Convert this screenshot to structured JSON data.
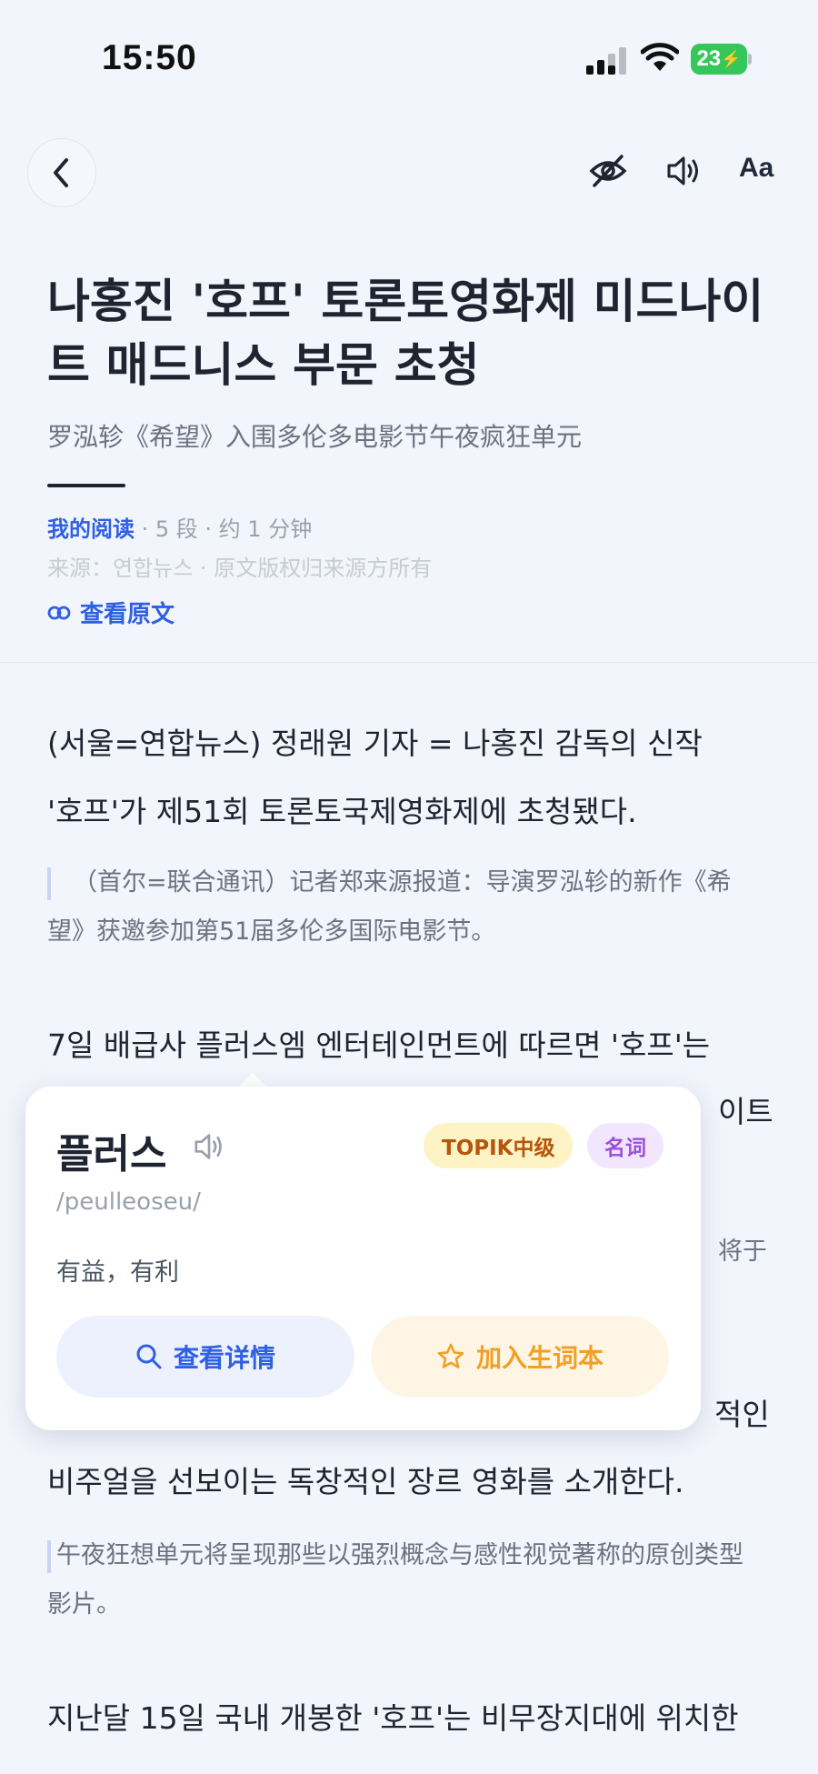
{
  "status_bar": {
    "time": "15:50",
    "battery": "23"
  },
  "nav": {
    "font_button": "Aa"
  },
  "article": {
    "title": "나홍진 '호프' 토론토영화제 미드나이트 매드니스 부문 초청",
    "subtitle": "罗泓轸《希望》入围多伦多电影节午夜疯狂单元",
    "meta": {
      "my_reading": "我的阅读",
      "stats": " · 5 段 · 约 1 分钟",
      "source": "来源：연합뉴스 · 原文版权归来源方所有",
      "view_original": "查看原文"
    },
    "paragraphs": [
      {
        "ko_lines": [
          "(서울=연합뉴스) 정래원 기자 = 나홍진 감독의 신작",
          "'호프'가 제51회 토론토국제영화제에 초청됐다."
        ],
        "zh": "（首尔=联合通讯）记者郑来源报道：导演罗泓轸的新作《希望》获邀参加第51届多伦多国际电影节。"
      },
      {
        "ko_line1": "7일 배급사 플러스엠 엔터테인먼트에 따르면 '호프'는",
        "ko_line2_tail": "이트",
        "zh_tail": "将于"
      },
      {
        "ko_line1_tail": "적인",
        "ko_line2": "비주얼을 선보이는 독창적인 장르 영화를 소개한다.",
        "zh": "午夜狂想单元将呈现那些以强烈概念与感性视觉著称的原创类型影片。"
      },
      {
        "ko_line1": "지난달 15일 국내 개봉한 '호프'는 비무장지대에 위치한"
      }
    ]
  },
  "word_popup": {
    "word": "플러스",
    "tag_level": "TOPIK中级",
    "tag_pos": "名词",
    "romanization": "/peulleoseu/",
    "definition": "有益，有利",
    "detail_button": "查看详情",
    "vocab_button": "加入生词本"
  },
  "colors": {
    "background": "#f3f5fd",
    "accent_blue": "#2f5fe3",
    "vocab_orange": "#f2a024",
    "battery_green": "#35c759"
  },
  "icons": [
    "chevron-left-icon",
    "eye-off-icon",
    "speaker-icon",
    "link-icon",
    "search-icon",
    "star-icon"
  ]
}
